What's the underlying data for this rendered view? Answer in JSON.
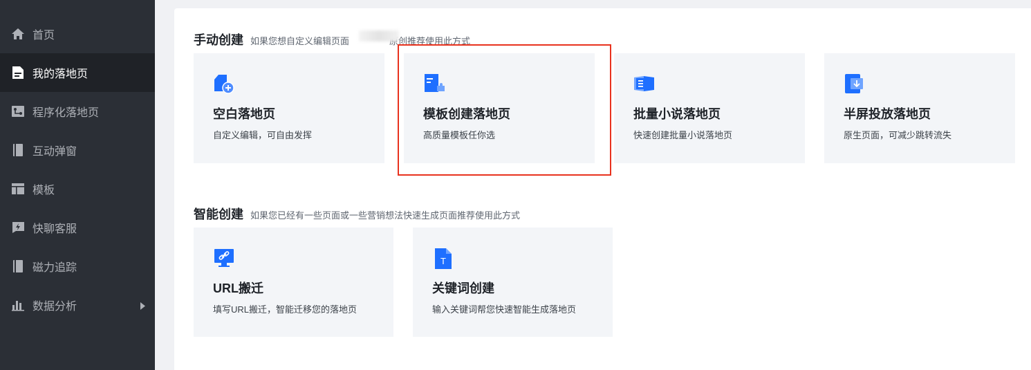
{
  "sidebar": {
    "items": [
      {
        "label": "首页",
        "icon": "home-icon"
      },
      {
        "label": "我的落地页",
        "icon": "document-icon",
        "active": true
      },
      {
        "label": "程序化落地页",
        "icon": "flow-icon"
      },
      {
        "label": "互动弹窗",
        "icon": "book-icon"
      },
      {
        "label": "模板",
        "icon": "template-icon"
      },
      {
        "label": "快聊客服",
        "icon": "chat-bolt-icon"
      },
      {
        "label": "磁力追踪",
        "icon": "book-icon"
      },
      {
        "label": "数据分析",
        "icon": "bar-chart-icon",
        "has_submenu": true
      }
    ]
  },
  "manual": {
    "title": "手动创建",
    "desc_prefix": "如果您想自定义编辑页面",
    "desc_suffix": "原创推荐使用此方式",
    "cards": [
      {
        "title": "空白落地页",
        "desc": "自定义编辑，可自由发挥",
        "icon": "blank-page-add-icon"
      },
      {
        "title": "模板创建落地页",
        "desc": "高质量模板任你选",
        "icon": "template-doc-icon"
      },
      {
        "title": "批量小说落地页",
        "desc": "快速创建批量小说落地页",
        "icon": "open-book-icon"
      },
      {
        "title": "半屏投放落地页",
        "desc": "原生页面，可减少跳转流失",
        "icon": "half-screen-download-icon"
      }
    ]
  },
  "smart": {
    "title": "智能创建",
    "desc": "如果您已经有一些页面或一些营销想法快速生成页面推荐使用此方式",
    "cards": [
      {
        "title": "URL搬迁",
        "desc": "填写URL搬迁，智能迁移您的落地页",
        "icon": "monitor-link-icon"
      },
      {
        "title": "关键词创建",
        "desc": "输入关键词帮您快速智能生成落地页",
        "icon": "text-doc-icon"
      }
    ]
  },
  "colors": {
    "accent": "#1e6fff",
    "highlight": "#e8321e",
    "sidebar_bg": "#2b2f36"
  }
}
